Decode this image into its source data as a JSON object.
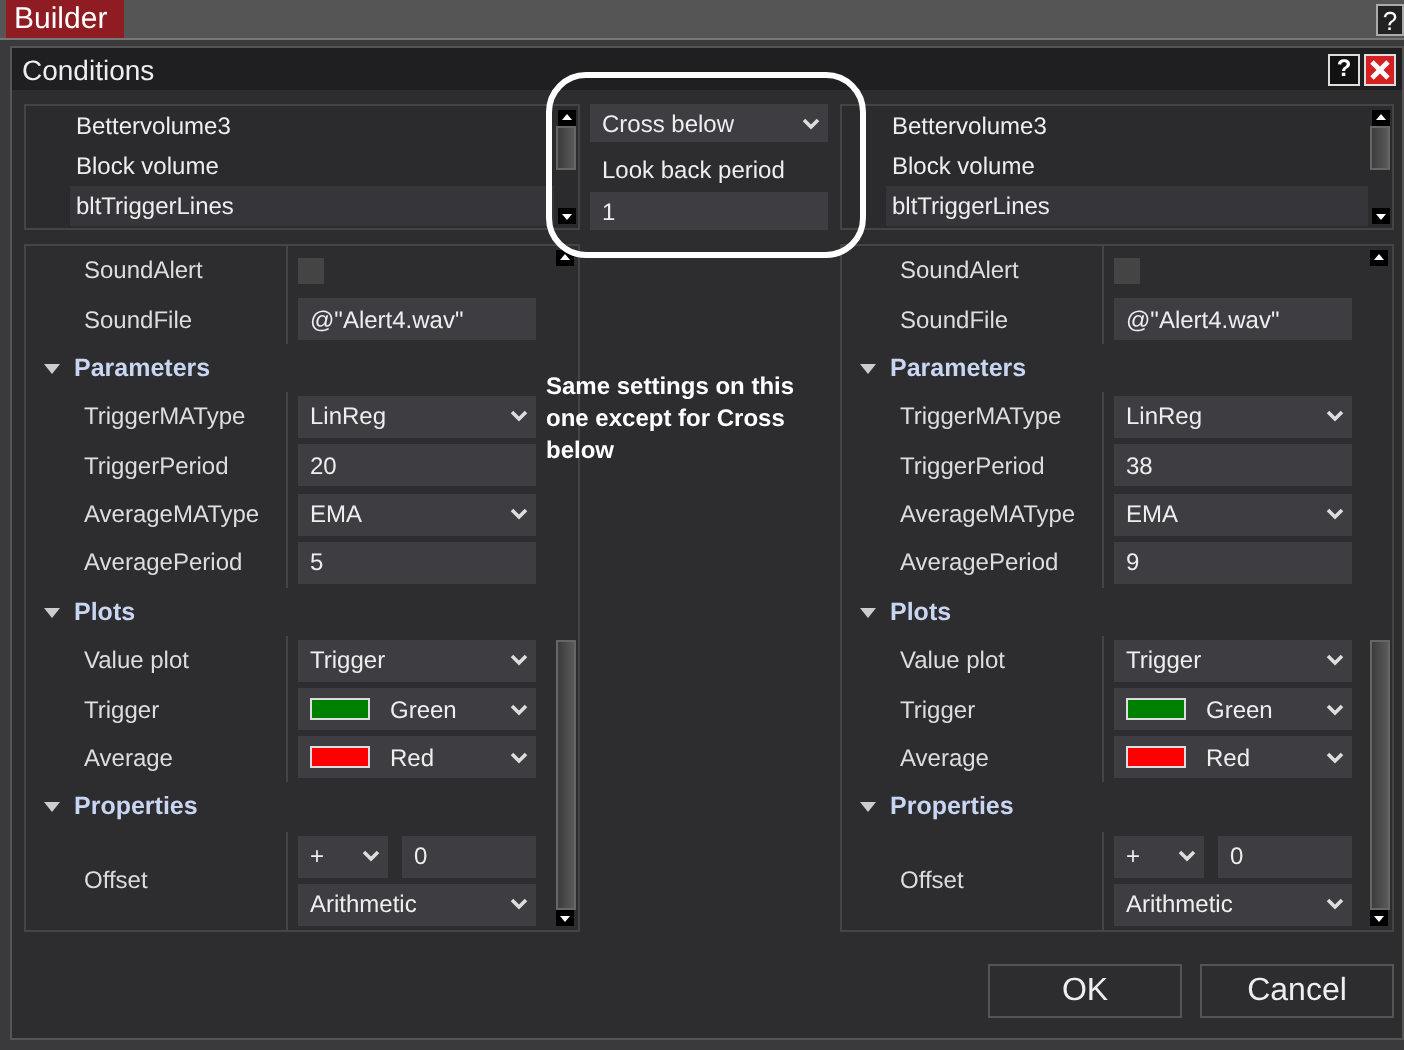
{
  "app": {
    "tab": "Builder",
    "help": "?"
  },
  "dialog": {
    "title": "Conditions",
    "help": "?"
  },
  "panels": [
    {
      "list": [
        {
          "label": "Bettervolume3",
          "selected": false
        },
        {
          "label": "Block volume",
          "selected": false
        },
        {
          "label": "bltTriggerLines",
          "selected": true
        }
      ],
      "rows": [
        {
          "kind": "check",
          "label": "SoundAlert",
          "checked": false
        },
        {
          "kind": "text",
          "label": "SoundFile",
          "value": "@\"Alert4.wav\""
        },
        {
          "kind": "group",
          "label": "Parameters",
          "expanded": true
        },
        {
          "kind": "select",
          "label": "TriggerMAType",
          "value": "LinReg"
        },
        {
          "kind": "text",
          "label": "TriggerPeriod",
          "value": "20"
        },
        {
          "kind": "select",
          "label": "AverageMAType",
          "value": "EMA"
        },
        {
          "kind": "text",
          "label": "AveragePeriod",
          "value": "5"
        },
        {
          "kind": "group",
          "label": "Plots",
          "expanded": true
        },
        {
          "kind": "select",
          "label": "Value plot",
          "value": "Trigger"
        },
        {
          "kind": "color",
          "label": "Trigger",
          "value": "Green",
          "color": "#008000"
        },
        {
          "kind": "color",
          "label": "Average",
          "value": "Red",
          "color": "#ff0000"
        },
        {
          "kind": "group",
          "label": "Properties",
          "expanded": true
        },
        {
          "kind": "offset",
          "label": "Offset",
          "sign": "+",
          "value": "0",
          "method": "Arithmetic"
        }
      ]
    },
    {
      "list": [
        {
          "label": "Bettervolume3",
          "selected": false
        },
        {
          "label": "Block volume",
          "selected": false
        },
        {
          "label": "bltTriggerLines",
          "selected": true
        }
      ],
      "rows": [
        {
          "kind": "check",
          "label": "SoundAlert",
          "checked": false
        },
        {
          "kind": "text",
          "label": "SoundFile",
          "value": "@\"Alert4.wav\""
        },
        {
          "kind": "group",
          "label": "Parameters",
          "expanded": true
        },
        {
          "kind": "select",
          "label": "TriggerMAType",
          "value": "LinReg"
        },
        {
          "kind": "text",
          "label": "TriggerPeriod",
          "value": "38"
        },
        {
          "kind": "select",
          "label": "AverageMAType",
          "value": "EMA"
        },
        {
          "kind": "text",
          "label": "AveragePeriod",
          "value": "9"
        },
        {
          "kind": "group",
          "label": "Plots",
          "expanded": true
        },
        {
          "kind": "select",
          "label": "Value plot",
          "value": "Trigger"
        },
        {
          "kind": "color",
          "label": "Trigger",
          "value": "Green",
          "color": "#008000"
        },
        {
          "kind": "color",
          "label": "Average",
          "value": "Red",
          "color": "#ff0000"
        },
        {
          "kind": "group",
          "label": "Properties",
          "expanded": true
        },
        {
          "kind": "offset",
          "label": "Offset",
          "sign": "+",
          "value": "0",
          "method": "Arithmetic"
        }
      ]
    }
  ],
  "middle": {
    "operator": "Cross below",
    "lookback_label": "Look back period",
    "lookback": "1",
    "note": "Same settings on this one except for Cross below"
  },
  "buttons": [
    {
      "label": "OK"
    },
    {
      "label": "Cancel"
    }
  ]
}
